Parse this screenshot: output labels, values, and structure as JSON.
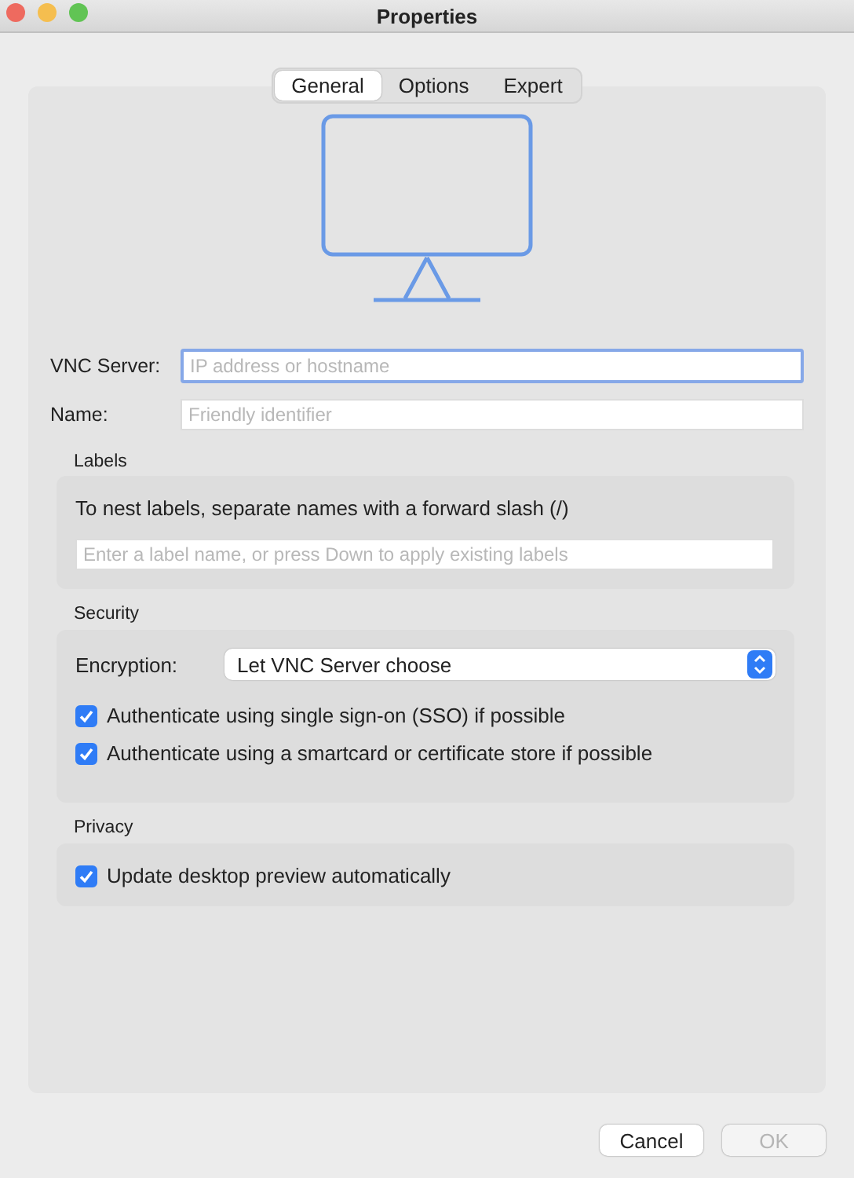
{
  "window": {
    "title": "Properties"
  },
  "tabs": [
    {
      "label": "General",
      "selected": true
    },
    {
      "label": "Options",
      "selected": false
    },
    {
      "label": "Expert",
      "selected": false
    }
  ],
  "fields": [
    {
      "label": "VNC Server:",
      "placeholder": "IP address or hostname",
      "focused": true
    },
    {
      "label": "Name:",
      "placeholder": "Friendly identifier",
      "focused": false
    }
  ],
  "labels": {
    "heading": "Labels",
    "hint": "To nest labels, separate names with a forward slash (/)",
    "placeholder": "Enter a label name, or press Down to apply existing labels"
  },
  "security": {
    "heading": "Security",
    "encryption_label": "Encryption:",
    "encryption_value": "Let VNC Server choose",
    "options": [
      {
        "label": "Authenticate using single sign-on (SSO) if possible",
        "checked": true
      },
      {
        "label": "Authenticate using a smartcard or certificate store if possible",
        "checked": true
      }
    ]
  },
  "privacy": {
    "heading": "Privacy",
    "options": [
      {
        "label": "Update desktop preview automatically",
        "checked": true
      }
    ]
  },
  "buttons": [
    {
      "label": "Cancel",
      "disabled": false
    },
    {
      "label": "OK",
      "disabled": true
    }
  ]
}
